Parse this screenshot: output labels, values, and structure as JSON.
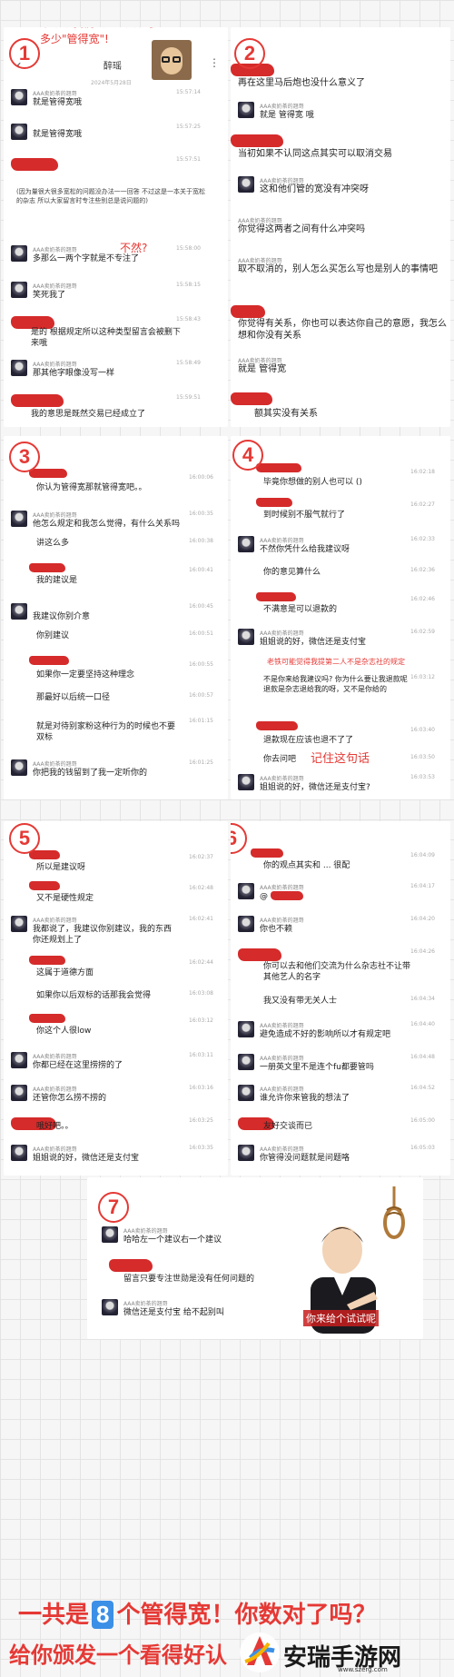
{
  "panel1": {
    "number": "1",
    "title": "来数数我们Is姐一共说了多少\"管得宽\"!",
    "chat_name": "醉瑶",
    "date": "2024年5月28日",
    "messages": [
      {
        "sender": "AAA卖奶茶的翘哥",
        "text": "就是管得宽哦",
        "time": "15:57:14"
      },
      {
        "sender": "",
        "text": "就是管得宽哦",
        "time": "15:57:25"
      },
      {
        "sender": "",
        "text": "",
        "time": "15:57:51"
      },
      {
        "sender": "",
        "text": "(因为量很大很多宽松的问题没办法一一回答 不过这是一本关于宽松的杂志 所以大家留言时专注些别总是说问题的)",
        "time": ""
      },
      {
        "sender": "AAA卖奶茶的翘哥",
        "text": "多那么一两个字就是不专注了",
        "time": "15:58:00"
      },
      {
        "sender": "AAA卖奶茶的翘哥",
        "text": "笑死我了",
        "time": "15:58:15"
      },
      {
        "sender": "",
        "text": "是的 根据规定所以这种类型留言会被删下来哦",
        "time": "15:58:43"
      },
      {
        "sender": "AAA卖奶茶的翘哥",
        "text": "那其他字眼像没写一样",
        "time": "15:58:49"
      },
      {
        "sender": "",
        "text": "我的意思是既然交易已经成立了",
        "time": "15:59:51"
      }
    ],
    "annotation": "不然?"
  },
  "panel2": {
    "number": "2",
    "messages": [
      {
        "sender": "",
        "text": "再在这里马后炮也没什么意义了",
        "time": ""
      },
      {
        "sender": "AAA卖奶茶的翘哥",
        "text": "就是 管得宽 哦",
        "time": ""
      },
      {
        "sender": "",
        "text": "当初如果不认同这点其实可以取消交易",
        "time": ""
      },
      {
        "sender": "AAA卖奶茶的翘哥",
        "text": "这和他们管的宽没有冲突呀",
        "time": ""
      },
      {
        "sender": "AAA卖奶茶的翘哥",
        "text": "你觉得这两者之间有什么冲突吗",
        "time": ""
      },
      {
        "sender": "AAA卖奶茶的翘哥",
        "text": "取不取消的，别人怎么买怎么写也是别人的事情吧",
        "time": ""
      },
      {
        "sender": "",
        "text": "你觉得有关系，你也可以表达你自己的意愿，我怎么想和你没有关系",
        "time": ""
      },
      {
        "sender": "AAA卖奶茶的翘哥",
        "text": "就是 管得宽",
        "time": ""
      },
      {
        "sender": "",
        "text": "额其实没有关系",
        "time": ""
      }
    ]
  },
  "panel3": {
    "number": "3",
    "messages": [
      {
        "sender": "",
        "text": "你认为管得宽那就管得宽吧。。",
        "time": "16:00:06"
      },
      {
        "sender": "AAA卖奶茶的翘哥",
        "text": "他怎么规定和我怎么觉得，有什么关系吗",
        "time": "16:00:35"
      },
      {
        "sender": "AAA卖奶茶的翘哥",
        "text": "讲这么多",
        "time": "16:00:38"
      },
      {
        "sender": "",
        "text": "我的建议是",
        "time": "16:00:41"
      },
      {
        "sender": "AAA卖奶茶的翘哥",
        "text": "我建议你别介意",
        "time": "16:00:45"
      },
      {
        "sender": "AAA卖奶茶的翘哥",
        "text": "你别建议",
        "time": "16:00:51"
      },
      {
        "sender": "",
        "text": "如果你一定要坚持这种理念",
        "time": "16:00:55"
      },
      {
        "sender": "",
        "text": "那最好以后统一口径",
        "time": "16:00:57"
      },
      {
        "sender": "",
        "text": "就是对待别家粉这种行为的时候也不要双标",
        "time": "16:01:15"
      },
      {
        "sender": "AAA卖奶茶的翘哥",
        "text": "你把我的钱留到了我一定听你的",
        "time": "16:01:25"
      }
    ]
  },
  "panel4": {
    "number": "4",
    "messages": [
      {
        "sender": "",
        "text": "毕竟你想做的别人也可以 ()",
        "time": "16:02:18"
      },
      {
        "sender": "",
        "text": "到时候别不服气就行了",
        "time": "16:02:27"
      },
      {
        "sender": "AAA卖奶茶的翘哥",
        "text": "不然你凭什么给我建议呀",
        "time": "16:02:33"
      },
      {
        "sender": "AAA卖奶茶的翘哥",
        "text": "你的意见算什么",
        "time": "16:02:36"
      },
      {
        "sender": "",
        "text": "不满意是可以退款的",
        "time": "16:02:46"
      },
      {
        "sender": "AAA卖奶茶的翘哥",
        "text": "姐姐说的好，微信还是支付宝",
        "time": "16:02:59"
      },
      {
        "sender": "AAA卖奶茶的翘哥",
        "text": "不是你来给我建议吗? 你为什么要让我退款呢 退款是杂志退给我的呀，又不是你给的",
        "time": "16:03:12"
      },
      {
        "sender": "",
        "text": "退款现在应该也退不了了",
        "time": "16:03:40"
      },
      {
        "sender": "",
        "text": "你去问吧",
        "time": "16:03:50"
      },
      {
        "sender": "AAA卖奶茶的翘哥",
        "text": "姐姐说的好，微信还是支付宝?",
        "time": "16:03:53"
      }
    ],
    "annotations": [
      "老铁可能觉得我提第二人不是杂志社的规定",
      "记住这句话"
    ]
  },
  "panel5": {
    "number": "5",
    "messages": [
      {
        "sender": "",
        "text": "所以是建议呀",
        "time": "16:02:37"
      },
      {
        "sender": "",
        "text": "又不是硬性规定",
        "time": "16:02:48"
      },
      {
        "sender": "AAA卖奶茶的翘哥",
        "text": "我都说了，我建议你别建议，我的东西你还规划上了",
        "time": "16:02:41"
      },
      {
        "sender": "",
        "text": "这属于道德方面",
        "time": "16:02:44"
      },
      {
        "sender": "",
        "text": "如果你以后双标的话那我会觉得",
        "time": "16:03:08"
      },
      {
        "sender": "",
        "text": "你这个人很low",
        "time": "16:03:12"
      },
      {
        "sender": "AAA卖奶茶的翘哥",
        "text": "你都已经在这里捞捞的了",
        "time": "16:03:11"
      },
      {
        "sender": "AAA卖奶茶的翘哥",
        "text": "还管你怎么捞不捞的",
        "time": "16:03:16"
      },
      {
        "sender": "",
        "text": "哦好吧。。",
        "time": "16:03:25"
      },
      {
        "sender": "AAA卖奶茶的翘哥",
        "text": "姐姐说的好，微信还是支付宝",
        "time": "16:03:35"
      }
    ]
  },
  "panel6": {
    "number": "6",
    "messages": [
      {
        "sender": "",
        "text": "你的观点其实和 ... 很配",
        "time": "16:04:09"
      },
      {
        "sender": "AAA卖奶茶的翘哥",
        "text": "@",
        "time": "16:04:17"
      },
      {
        "sender": "AAA卖奶茶的翘哥",
        "text": "你也不赖",
        "time": "16:04:20"
      },
      {
        "sender": "",
        "text": "你可以去和他们交流为什么杂志社不让带其他艺人的名字",
        "time": "16:04:26"
      },
      {
        "sender": "",
        "text": "我又没有带无关人士",
        "time": "16:04:34"
      },
      {
        "sender": "AAA卖奶茶的翘哥",
        "text": "避免造成不好的影响所以才有规定吧",
        "time": "16:04:40"
      },
      {
        "sender": "AAA卖奶茶的翘哥",
        "text": "一册英文里不是连个fu都要管吗",
        "time": "16:04:48"
      },
      {
        "sender": "AAA卖奶茶的翘哥",
        "text": "谁允许你来管我的想法了",
        "time": "16:04:52"
      },
      {
        "sender": "",
        "text": "友好交谈而已",
        "time": "16:05:00"
      },
      {
        "sender": "AAA卖奶茶的翘哥",
        "text": "你管得没问题就是问题咯",
        "time": "16:05:03"
      }
    ]
  },
  "panel7": {
    "number": "7",
    "messages": [
      {
        "sender": "AAA卖奶茶的翘哥",
        "text": "哈哈左一个建议右一个建议",
        "time": ""
      },
      {
        "sender": "",
        "text": "留言只要专注世勋是没有任何问题的",
        "time": ""
      },
      {
        "sender": "AAA卖奶茶的翘哥",
        "text": "微信还是支付宝 给不起别叫",
        "time": ""
      }
    ],
    "image_caption": "你来给个试试呢"
  },
  "footer": {
    "line1_a": "一共是",
    "line1_num": "8",
    "line1_b": "个管得宽！你数对了吗？",
    "line2": "给你颁发一个看得好认",
    "watermark": "安瑞手游网",
    "watermark_url": "www.szerg.com"
  },
  "colors": {
    "accent_red": "#e53935",
    "scribble_red": "#d32020",
    "number_badge_blue": "#3b8fe6"
  }
}
